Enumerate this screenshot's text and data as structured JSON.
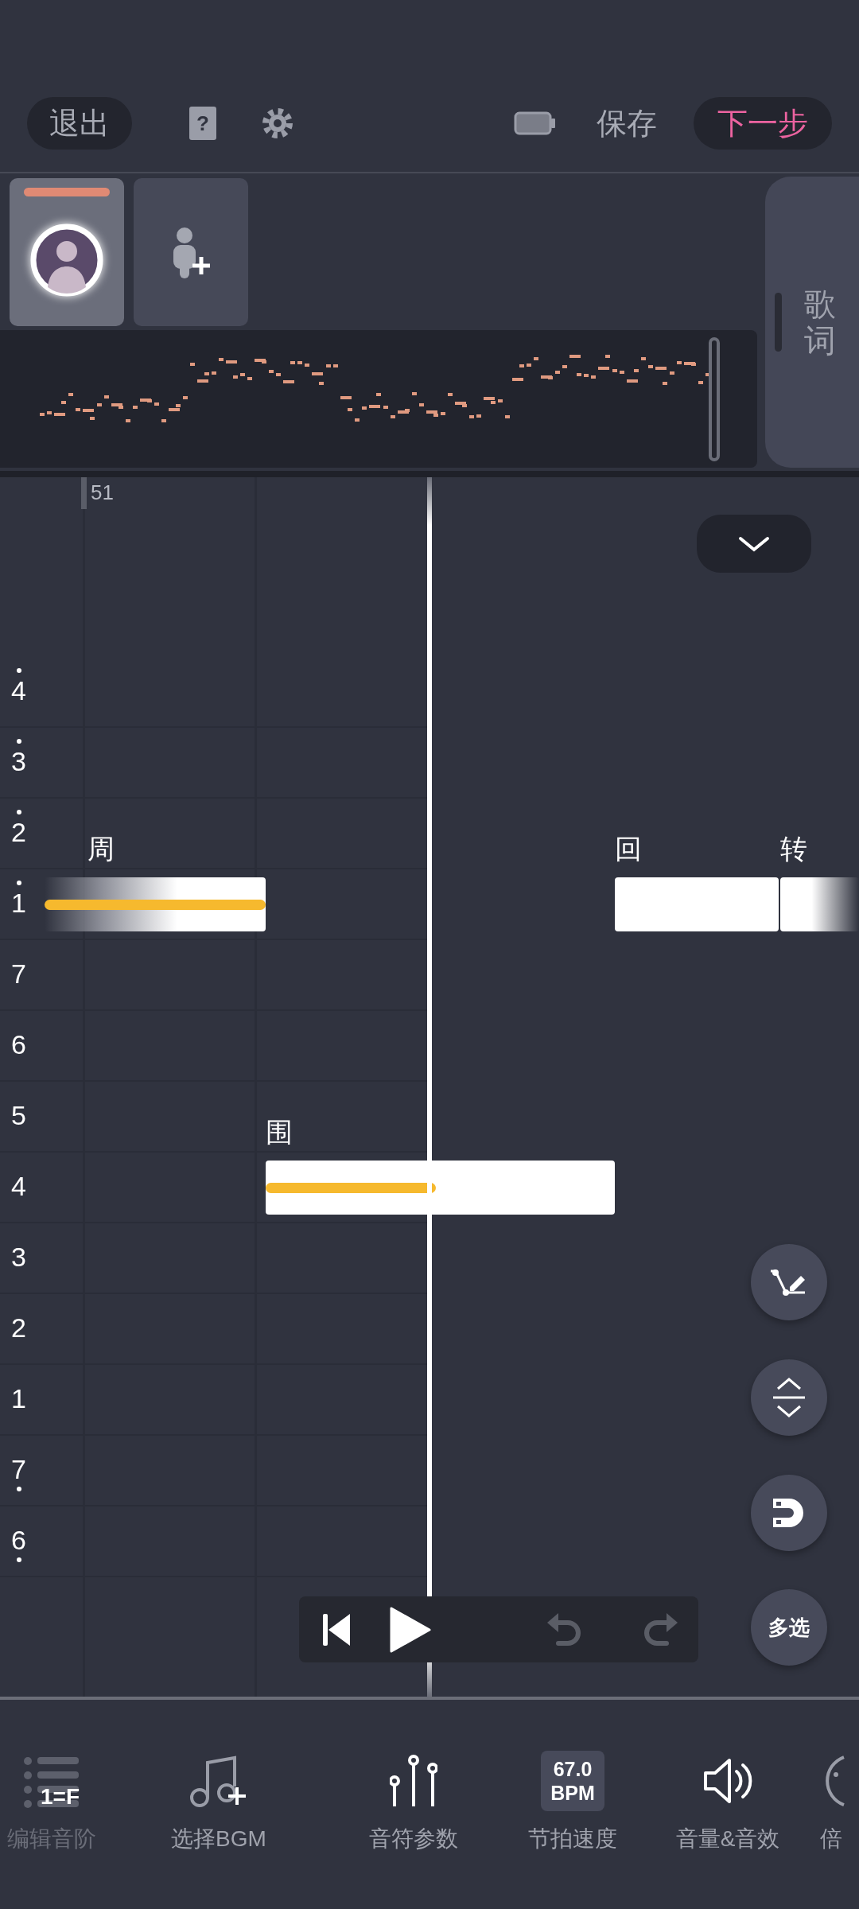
{
  "top_bar": {
    "exit_button": "退出",
    "help_button": "?",
    "save_button": "保存",
    "next_button": "下一步"
  },
  "tracks": [
    {
      "kind": "singer",
      "selected": true
    },
    {
      "kind": "add",
      "selected": false
    }
  ],
  "lyrics_tab": "歌词",
  "ruler": {
    "bar_number": "51"
  },
  "scale_rows": [
    {
      "label": "4",
      "dot_above": true,
      "dot_below": false
    },
    {
      "label": "3",
      "dot_above": true,
      "dot_below": false
    },
    {
      "label": "2",
      "dot_above": true,
      "dot_below": false
    },
    {
      "label": "1",
      "dot_above": true,
      "dot_below": false
    },
    {
      "label": "7",
      "dot_above": false,
      "dot_below": false
    },
    {
      "label": "6",
      "dot_above": false,
      "dot_below": false
    },
    {
      "label": "5",
      "dot_above": false,
      "dot_below": false
    },
    {
      "label": "4",
      "dot_above": false,
      "dot_below": false
    },
    {
      "label": "3",
      "dot_above": false,
      "dot_below": false
    },
    {
      "label": "2",
      "dot_above": false,
      "dot_below": false
    },
    {
      "label": "1",
      "dot_above": false,
      "dot_below": false
    },
    {
      "label": "7",
      "dot_above": false,
      "dot_below": true
    },
    {
      "label": "6",
      "dot_above": false,
      "dot_below": true
    }
  ],
  "notes": [
    {
      "lyric": "周",
      "pitch_curve": true
    },
    {
      "lyric": "围",
      "pitch_curve": true
    },
    {
      "lyric": "回",
      "pitch_curve": false
    },
    {
      "lyric": "转",
      "pitch_curve": false
    }
  ],
  "transport": {
    "undo_disabled": true,
    "redo_disabled": true
  },
  "tools": [
    {
      "kind": "pitch-edit"
    },
    {
      "kind": "transpose"
    },
    {
      "kind": "snap"
    },
    {
      "kind": "multi-select",
      "label": "多选"
    }
  ],
  "bottom_toolbar": [
    {
      "kind": "scale",
      "badge": "1=F",
      "label": "编辑音阶",
      "disabled": true
    },
    {
      "kind": "bgm",
      "label": "选择BGM",
      "disabled": false
    },
    {
      "kind": "params",
      "label": "音符参数",
      "disabled": false
    },
    {
      "kind": "tempo",
      "value": "67.0",
      "unit": "BPM",
      "label": "节拍速度",
      "disabled": false
    },
    {
      "kind": "volume",
      "label": "音量&音效",
      "disabled": false
    },
    {
      "kind": "speed",
      "label": "倍",
      "disabled": false
    }
  ]
}
